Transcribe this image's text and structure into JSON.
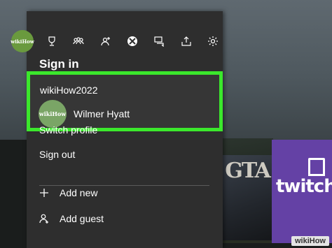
{
  "watermark": "wikiHow",
  "background": {
    "gta_text": "GTA",
    "twitch_text": "twitch"
  },
  "guide": {
    "avatar_text": "wikiHow",
    "top_icons": [
      "trophy-icon",
      "friends-icon",
      "party-icon",
      "xbox-icon",
      "messages-icon",
      "upload-icon",
      "settings-icon"
    ],
    "title": "Sign in",
    "selected_account": {
      "gamertag": "wikiHow2022",
      "avatar_text": "wikiHow",
      "name": "Wilmer Hyatt"
    },
    "menu": {
      "switch_profile": "Switch profile",
      "sign_out": "Sign out",
      "add_new": "Add new",
      "add_guest": "Add guest"
    }
  },
  "colors": {
    "panel": "#2e2e2e",
    "highlight": "#3be82c",
    "avatar": "#6a9a3e",
    "twitch": "#6441a5"
  }
}
